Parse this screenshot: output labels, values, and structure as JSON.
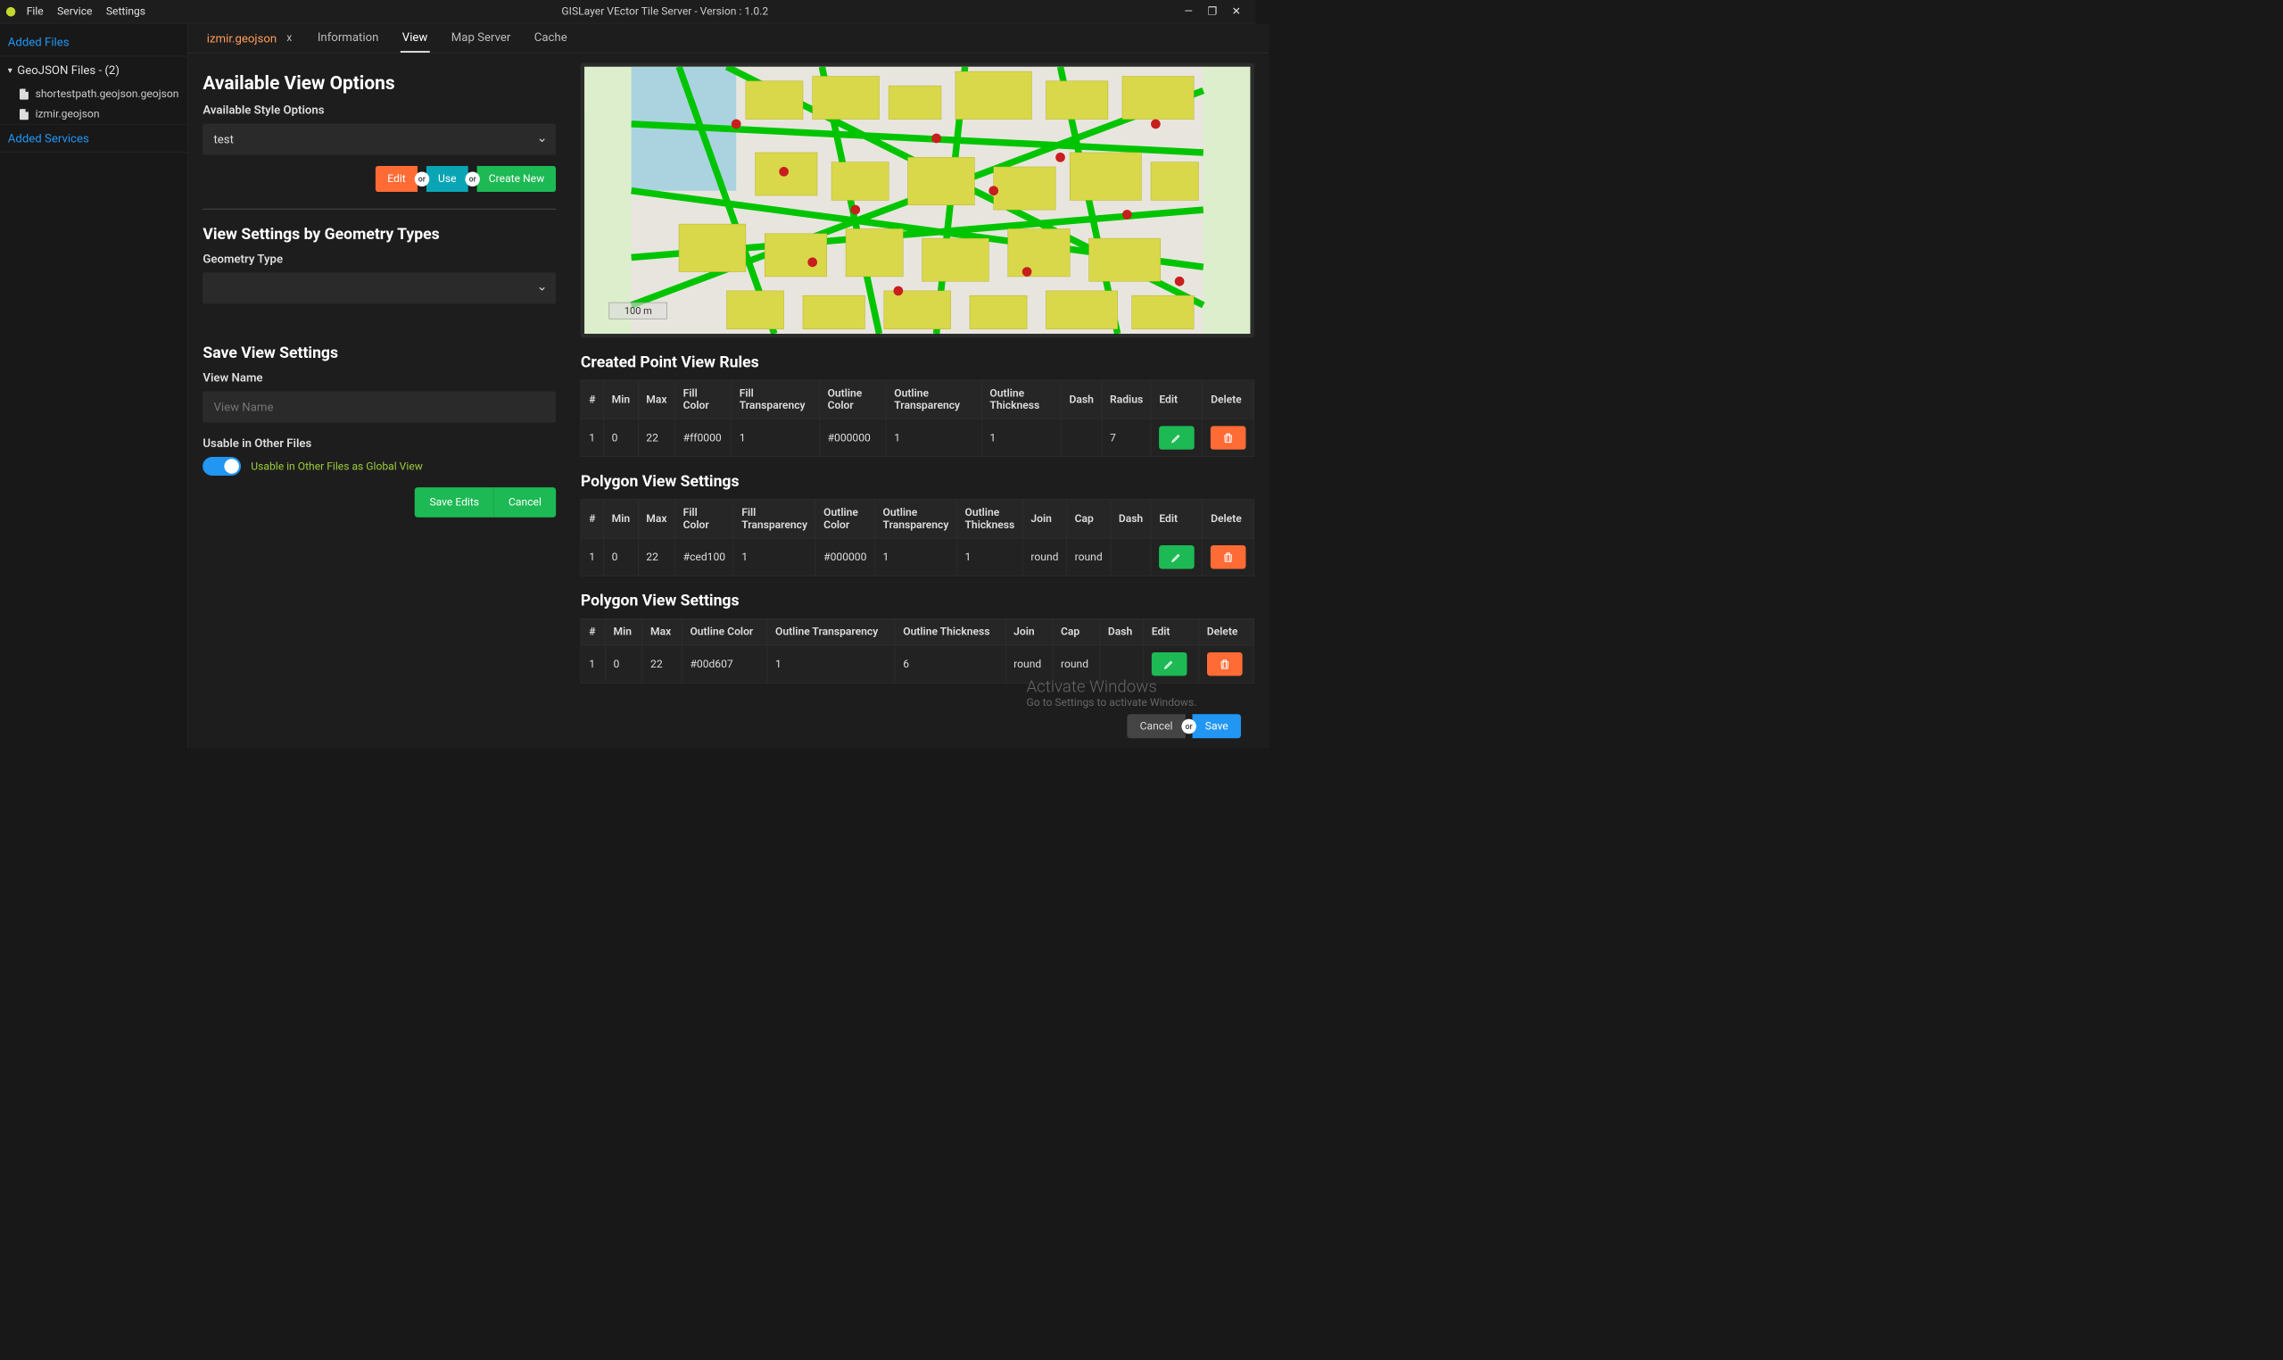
{
  "titlebar": {
    "menu": [
      "File",
      "Service",
      "Settings"
    ],
    "title": "GISLayer VEctor Tile Server - Version : 1.0.2"
  },
  "sidebar": {
    "added_files": "Added Files",
    "group_label": "GeoJSON Files - (2)",
    "files": [
      "shortestpath.geojson.geojson",
      "izmir.geojson"
    ],
    "added_services": "Added Services"
  },
  "file_tab": {
    "name": "izmir.geojson",
    "close": "x"
  },
  "inner_tabs": [
    "Information",
    "View",
    "Map Server",
    "Cache"
  ],
  "left": {
    "h1": "Available View Options",
    "style_label": "Available Style Options",
    "style_value": "test",
    "edit": "Edit",
    "or": "or",
    "use": "Use",
    "create": "Create New",
    "geom_h": "View Settings by Geometry Types",
    "geom_label": "Geometry Type",
    "save_h": "Save View Settings",
    "viewname_label": "View Name",
    "viewname_ph": "View Name",
    "usable_label": "Usable in Other Files",
    "usable_toggle": "Usable in Other Files as Global View",
    "save_edits": "Save Edits",
    "cancel": "Cancel"
  },
  "map": {
    "scale": "100 m"
  },
  "tables": {
    "point": {
      "title": "Created Point View Rules",
      "headers": [
        "#",
        "Min",
        "Max",
        "Fill Color",
        "Fill Transparency",
        "Outline Color",
        "Outline Transparency",
        "Outline Thickness",
        "Dash",
        "Radius",
        "Edit",
        "Delete"
      ],
      "row": [
        "1",
        "0",
        "22",
        "#ff0000",
        "1",
        "#000000",
        "1",
        "1",
        "",
        "7"
      ]
    },
    "poly1": {
      "title": "Polygon View Settings",
      "headers": [
        "#",
        "Min",
        "Max",
        "Fill Color",
        "Fill Transparency",
        "Outline Color",
        "Outline Transparency",
        "Outline Thickness",
        "Join",
        "Cap",
        "Dash",
        "Edit",
        "Delete"
      ],
      "row": [
        "1",
        "0",
        "22",
        "#ced100",
        "1",
        "#000000",
        "1",
        "1",
        "round",
        "round",
        ""
      ]
    },
    "poly2": {
      "title": "Polygon View Settings",
      "headers": [
        "#",
        "Min",
        "Max",
        "Outline Color",
        "Outline Transparency",
        "Outline Thickness",
        "Join",
        "Cap",
        "Dash",
        "Edit",
        "Delete"
      ],
      "row": [
        "1",
        "0",
        "22",
        "#00d607",
        "1",
        "6",
        "round",
        "round",
        ""
      ]
    }
  },
  "watermark": {
    "l1": "Activate Windows",
    "l2": "Go to Settings to activate Windows."
  },
  "footer": {
    "cancel": "Cancel",
    "or": "or",
    "save": "Save"
  }
}
